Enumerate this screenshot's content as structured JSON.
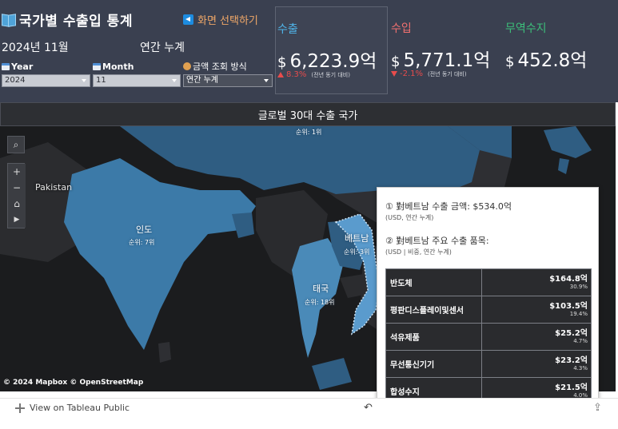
{
  "header": {
    "title": "국가별 수출입 통계",
    "screen_select": "화면 선택하기",
    "date": "2024년 11월",
    "cumulative": "연간 누계"
  },
  "filters": {
    "year": {
      "label": "Year",
      "value": "2024"
    },
    "month": {
      "label": "Month",
      "value": "11"
    },
    "amount": {
      "label": "금액 조회 방식",
      "value": "연간 누계"
    }
  },
  "kpis": {
    "export": {
      "label": "수출",
      "currency": "$",
      "value": "6,223.9억",
      "change": "8.3%",
      "note": "(전년 동기 대비)",
      "label_color": "#4fb4e8"
    },
    "import": {
      "label": "수입",
      "currency": "$",
      "value": "5,771.1억",
      "change": "-2.1%",
      "note": "(전년 동기 대비)",
      "label_color": "#f07070"
    },
    "balance": {
      "label": "무역수지",
      "currency": "$",
      "value": "452.8억",
      "label_color": "#3cbf7a"
    }
  },
  "map": {
    "title": "글로벌 30대 수출 국가",
    "labels": {
      "top_rank": "순위: 1위",
      "india_name": "인도",
      "india_rank": "순위: 7위",
      "thailand_name": "태국",
      "thailand_rank": "순위: 18위",
      "vietnam_name": "베트남",
      "vietnam_rank": "순위: 3위",
      "pakistan": "Pakistan"
    },
    "attribution": "© 2024 Mapbox  © OpenStreetMap"
  },
  "tooltip": {
    "line1": "① 對베트남 수출 금액: $534.0억",
    "line1_sub": "(USD,  연간 누계)",
    "line2": "② 對베트남 주요 수출 품목:",
    "line2_sub": "(USD | 비중,  연간 누계)",
    "items": [
      {
        "name": "반도체",
        "amount": "$164.8억",
        "share": "30.9%"
      },
      {
        "name": "평판디스플레이및센서",
        "amount": "$103.5억",
        "share": "19.4%"
      },
      {
        "name": "석유제품",
        "amount": "$25.2억",
        "share": "4.7%"
      },
      {
        "name": "무선통신기기",
        "amount": "$23.2억",
        "share": "4.3%"
      },
      {
        "name": "합성수지",
        "amount": "$21.5억",
        "share": "4.0%"
      }
    ]
  },
  "footer": {
    "link": "View on Tableau Public"
  }
}
